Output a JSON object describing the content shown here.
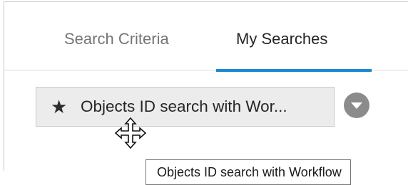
{
  "tabs": {
    "search_criteria": "Search Criteria",
    "my_searches": "My Searches",
    "active": "my_searches",
    "accent_color": "#1b8bd0"
  },
  "saved_search": {
    "icon": "star-icon",
    "label": "Objects ID search with Wor..."
  },
  "dropdown": {
    "icon": "chevron-down-icon"
  },
  "cursor": {
    "icon": "move-cursor-icon"
  },
  "tooltip": {
    "text": "Objects ID search with Workflow"
  }
}
